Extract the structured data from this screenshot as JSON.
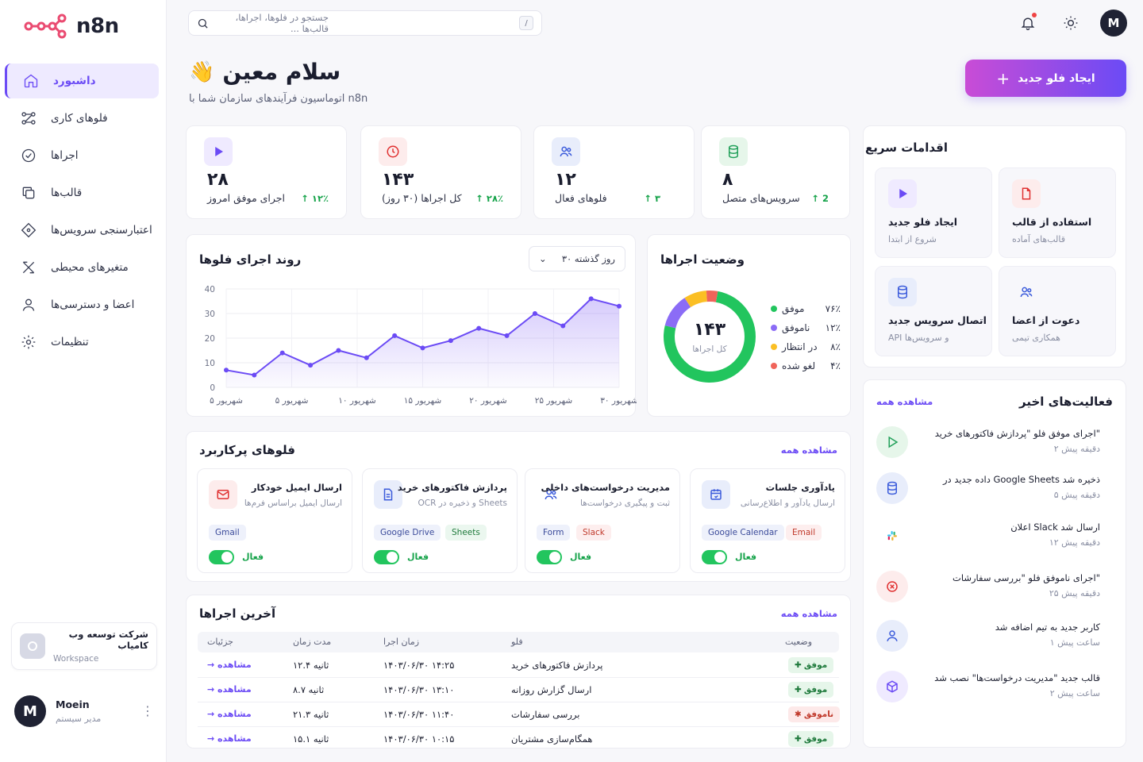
{
  "brand": {
    "name": "n8n"
  },
  "sidebar": {
    "items": [
      {
        "label": "داشبورد"
      },
      {
        "label": "فلوهای کاری"
      },
      {
        "label": "اجراها"
      },
      {
        "label": "قالب‌ها"
      },
      {
        "label": "اعتبارسنجی سرویس‌ها"
      },
      {
        "label": "متغیرهای محیطی"
      },
      {
        "label": "اعضا و دسترسی‌ها"
      },
      {
        "label": "تنظیمات"
      }
    ],
    "workspace": {
      "name": "شرکت توسعه وب کامیاب",
      "type": "Workspace"
    },
    "user": {
      "initial": "M",
      "name": "Moein",
      "role": "مدیر سیستم"
    }
  },
  "topbar": {
    "search_placeholder": "جستجو در فلوها، اجراها، قالب‌ها ...",
    "search_shortcut": "/",
    "avatar_initial": "M"
  },
  "greeting": {
    "title": "سلام معین",
    "emoji": "👋",
    "subtitle": "اتوماسیون فرآیندهای سازمان شما با n8n",
    "new_flow_label": "ایجاد فلو جدید"
  },
  "stats": [
    {
      "value": "۸",
      "label": "سرویس‌های متصل",
      "change": "↑ 2",
      "icon": "database-icon",
      "color": "#22a05a",
      "bg": "#e6f6ea"
    },
    {
      "value": "۱۲",
      "label": "فلوهای فعال",
      "change": "↑ ۳",
      "icon": "users-icon",
      "color": "#3b5bdb",
      "bg": "#e8edfb"
    },
    {
      "value": "۱۴۳",
      "label": "کل اجراها (۳۰ روز)",
      "change": "↑ ۲۸٪",
      "icon": "clock-icon",
      "color": "#e03131",
      "bg": "#fdecec"
    },
    {
      "value": "۲۸",
      "label": "اجرای موفق امروز",
      "change": "↑ ۱۲٪",
      "icon": "play-icon",
      "color": "#6b4bf5",
      "bg": "#efeaff"
    }
  ],
  "trend": {
    "title": "روند اجرای فلوها",
    "range": "۳۰ روز گذشته"
  },
  "chart_data": [
    {
      "type": "area",
      "title": "روند اجرای فلوها",
      "xlabel": "",
      "ylabel": "",
      "ylim": [
        0,
        40
      ],
      "yticks": [
        "0",
        "10",
        "20",
        "30",
        "40"
      ],
      "xticks": [
        "۵ شهریور",
        "۵ شهریور",
        "۱۰ شهریور",
        "۱۵ شهریور",
        "۲۰ شهریور",
        "۲۵ شهریور",
        "۳۰ شهریور"
      ],
      "values": [
        7,
        5,
        14,
        9,
        15,
        12,
        21,
        16,
        19,
        24,
        21,
        30,
        25,
        36,
        33
      ],
      "color": "#6b4bf5",
      "grid": true
    },
    {
      "type": "pie",
      "title": "وضعیت اجراها",
      "center_value": "۱۴۳",
      "center_label": "کل اجراها",
      "slices": [
        {
          "label": "موفق",
          "percent_label": "۷۶٪",
          "value": 76,
          "color": "#22c55e"
        },
        {
          "label": "ناموفق",
          "percent_label": "۱۲٪",
          "value": 12,
          "color": "#8b6cf6"
        },
        {
          "label": "در انتظار",
          "percent_label": "۸٪",
          "value": 8,
          "color": "#fbbf24"
        },
        {
          "label": "لغو شده",
          "percent_label": "۴٪",
          "value": 4,
          "color": "#f0645a"
        }
      ]
    }
  ],
  "quick_actions": {
    "title": "اقدامات سریع",
    "items": [
      {
        "title": "استفاده از قالب",
        "sub": "قالب‌های آماده",
        "icon": "file-icon",
        "color": "#e03131",
        "bg": "#fdecec"
      },
      {
        "title": "ایجاد فلو جدید",
        "sub": "شروع از ابتدا",
        "icon": "play-icon",
        "color": "#6b4bf5",
        "bg": "#efeaff"
      },
      {
        "title": "دعوت از اعضا",
        "sub": "همکاری تیمی",
        "icon": "users-icon",
        "color": "#3b5bdb",
        "bg": "#f7f7fb"
      },
      {
        "title": "اتصال سرویس جدید",
        "sub": "API و سرویس‌ها",
        "icon": "database-icon",
        "color": "#3b5bdb",
        "bg": "#e8edfb"
      }
    ]
  },
  "activity": {
    "title": "فعالیت‌های اخیر",
    "see_all": "مشاهده همه",
    "items": [
      {
        "text": "اجرای موفق فلو \"پردازش فاکتورهای خرید\"",
        "time": "۲ دقیقه پیش",
        "icon": "play-icon",
        "color": "#22a05a",
        "bg": "#e6f6ea"
      },
      {
        "text": "داده جدید در Google Sheets ذخیره شد",
        "time": "۵ دقیقه پیش",
        "icon": "database-icon",
        "color": "#3b5bdb",
        "bg": "#e8edfb"
      },
      {
        "text": "اعلان Slack ارسال شد",
        "time": "۱۲ دقیقه پیش",
        "icon": "slack-icon",
        "color": "#e01e5a",
        "bg": "#ffffff"
      },
      {
        "text": "اجرای ناموفق فلو \"بررسی سفارشات\"",
        "time": "۲۵ دقیقه پیش",
        "icon": "error-icon",
        "color": "#e03131",
        "bg": "#fdecec"
      },
      {
        "text": "کاربر جدید به تیم اضافه شد",
        "time": "۱ ساعت پیش",
        "icon": "user-icon",
        "color": "#3b5bdb",
        "bg": "#e8edfb"
      },
      {
        "text": "قالب جدید \"مدیریت درخواست‌ها\" نصب شد",
        "time": "۲ ساعت پیش",
        "icon": "box-icon",
        "color": "#6b4bf5",
        "bg": "#efeaff"
      }
    ]
  },
  "popular": {
    "title": "فلوهای پرکاربرد",
    "see_all": "مشاهده همه",
    "toggle_label": "فعال",
    "items": [
      {
        "title": "یادآوری جلسات",
        "sub": "ارسال یادآور و اطلاع‌رسانی",
        "tags": [
          "Google Calendar",
          "Email"
        ],
        "tagcolors": [
          "blue",
          "red"
        ],
        "icon": "calendar-icon",
        "color": "#3b5bdb",
        "bg": "#e8edfb"
      },
      {
        "title": "مدیریت درخواست‌های داخلی",
        "sub": "ثبت و پیگیری درخواست‌ها",
        "tags": [
          "Form",
          "Slack"
        ],
        "tagcolors": [
          "blue",
          "red"
        ],
        "icon": "users-icon",
        "color": "#3b5bdb",
        "bg": "#ffffff"
      },
      {
        "title": "پردازش فاکتورهای خرید",
        "sub": "OCR و ذخیره در Sheets",
        "tags": [
          "Google Drive",
          "Sheets"
        ],
        "tagcolors": [
          "blue",
          "green"
        ],
        "icon": "document-icon",
        "color": "#3b5bdb",
        "bg": "#e8edfb"
      },
      {
        "title": "ارسال ایمیل خودکار",
        "sub": "ارسال ایمیل براساس فرم‌ها",
        "tags": [
          "Gmail"
        ],
        "tagcolors": [
          "blue"
        ],
        "icon": "mail-icon",
        "color": "#e03131",
        "bg": "#fdecec"
      }
    ]
  },
  "runs": {
    "title": "آخرین اجراها",
    "see_all": "مشاهده همه",
    "columns": {
      "status": "وضعیت",
      "flow": "فلو",
      "time": "زمان اجرا",
      "duration": "مدت زمان",
      "details": "جزئیات"
    },
    "rows": [
      {
        "status": "موفق",
        "ok": true,
        "flow": "پردازش فاکتورهای خرید",
        "time": "۱۴۰۳/۰۶/۳۰ ۱۴:۲۵",
        "duration": "۱۲.۴ ثانیه",
        "link": "مشاهده"
      },
      {
        "status": "موفق",
        "ok": true,
        "flow": "ارسال گزارش روزانه",
        "time": "۱۴۰۳/۰۶/۳۰ ۱۳:۱۰",
        "duration": "۸.۷ ثانیه",
        "link": "مشاهده"
      },
      {
        "status": "ناموفق",
        "ok": false,
        "flow": "بررسی سفارشات",
        "time": "۱۴۰۳/۰۶/۳۰ ۱۱:۴۰",
        "duration": "۲۱.۳ ثانیه",
        "link": "مشاهده"
      },
      {
        "status": "موفق",
        "ok": true,
        "flow": "همگام‌سازی مشتریان",
        "time": "۱۴۰۳/۰۶/۳۰ ۱۰:۱۵",
        "duration": "۱۵.۱ ثانیه",
        "link": "مشاهده"
      }
    ]
  }
}
